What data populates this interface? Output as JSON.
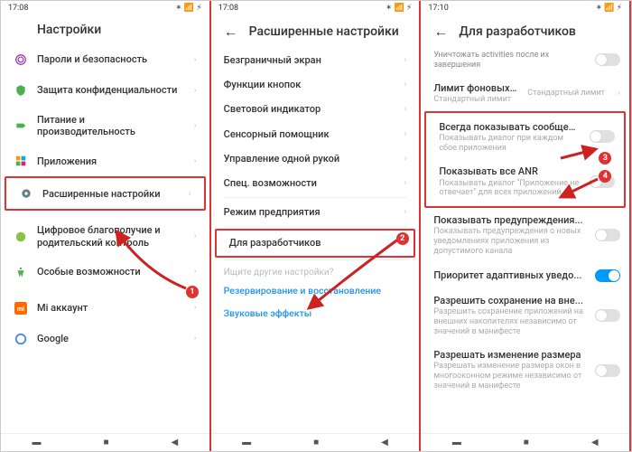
{
  "status": {
    "time1": "17:08",
    "time3": "17:10"
  },
  "panel1": {
    "title": "Настройки",
    "items": {
      "passwords": "Пароли и безопасность",
      "privacy": "Защита конфиденциальности",
      "battery": "Питание и производительность",
      "apps": "Приложения",
      "advanced": "Расширенные настройки",
      "wellbeing": "Цифровое благополучие и родительский контроль",
      "accessibility": "Особые возможности",
      "mi": "Mi аккаунт",
      "google": "Google"
    }
  },
  "panel2": {
    "title": "Расширенные настройки",
    "items": {
      "bezel": "Безграничный экран",
      "buttons": "Функции кнопок",
      "led": "Световой индикатор",
      "touch": "Сенсорный помощник",
      "onehand": "Управление одной рукой",
      "special": "Спец. возможности",
      "enterprise": "Режим предприятия",
      "developer": "Для разработчиков"
    },
    "search": "Ищите другие настройки?",
    "link1": "Резервирование и восстановление",
    "link2": "Звуковые эффекты"
  },
  "panel3": {
    "title": "Для разработчиков",
    "destroy": "Уничтожать activities после их завершения",
    "bglimit_t": "Лимит фоновых процессов",
    "bglimit_s": "Стандартный лимит",
    "bglimit_v": "Стандартный лимит",
    "crash_t": "Всегда показывать сообщени...",
    "crash_s": "Показывать диалог при каждом сбое приложения",
    "anr_t": "Показывать все ANR",
    "anr_s": "Показывать диалог \"Приложение не отвечает\" для всех приложений",
    "warn_t": "Показывать предупреждения...",
    "warn_s": "Показывать предупреждения о новых уведомлениях приложения из допустимого канала",
    "prio_t": "Приоритет адаптивных уведо...",
    "ext_t": "Разрешить сохранение на вне...",
    "ext_s": "Разрешить сохранение приложений на внешних накопителях независимо от значений в манифесте",
    "resize_t": "Разрешать изменение размера",
    "resize_s": "Разрешать изменение размера окон в многооконном режиме независимо от значений в манифесте"
  },
  "badges": {
    "b1": "1",
    "b2": "2",
    "b3": "3",
    "b4": "4"
  }
}
